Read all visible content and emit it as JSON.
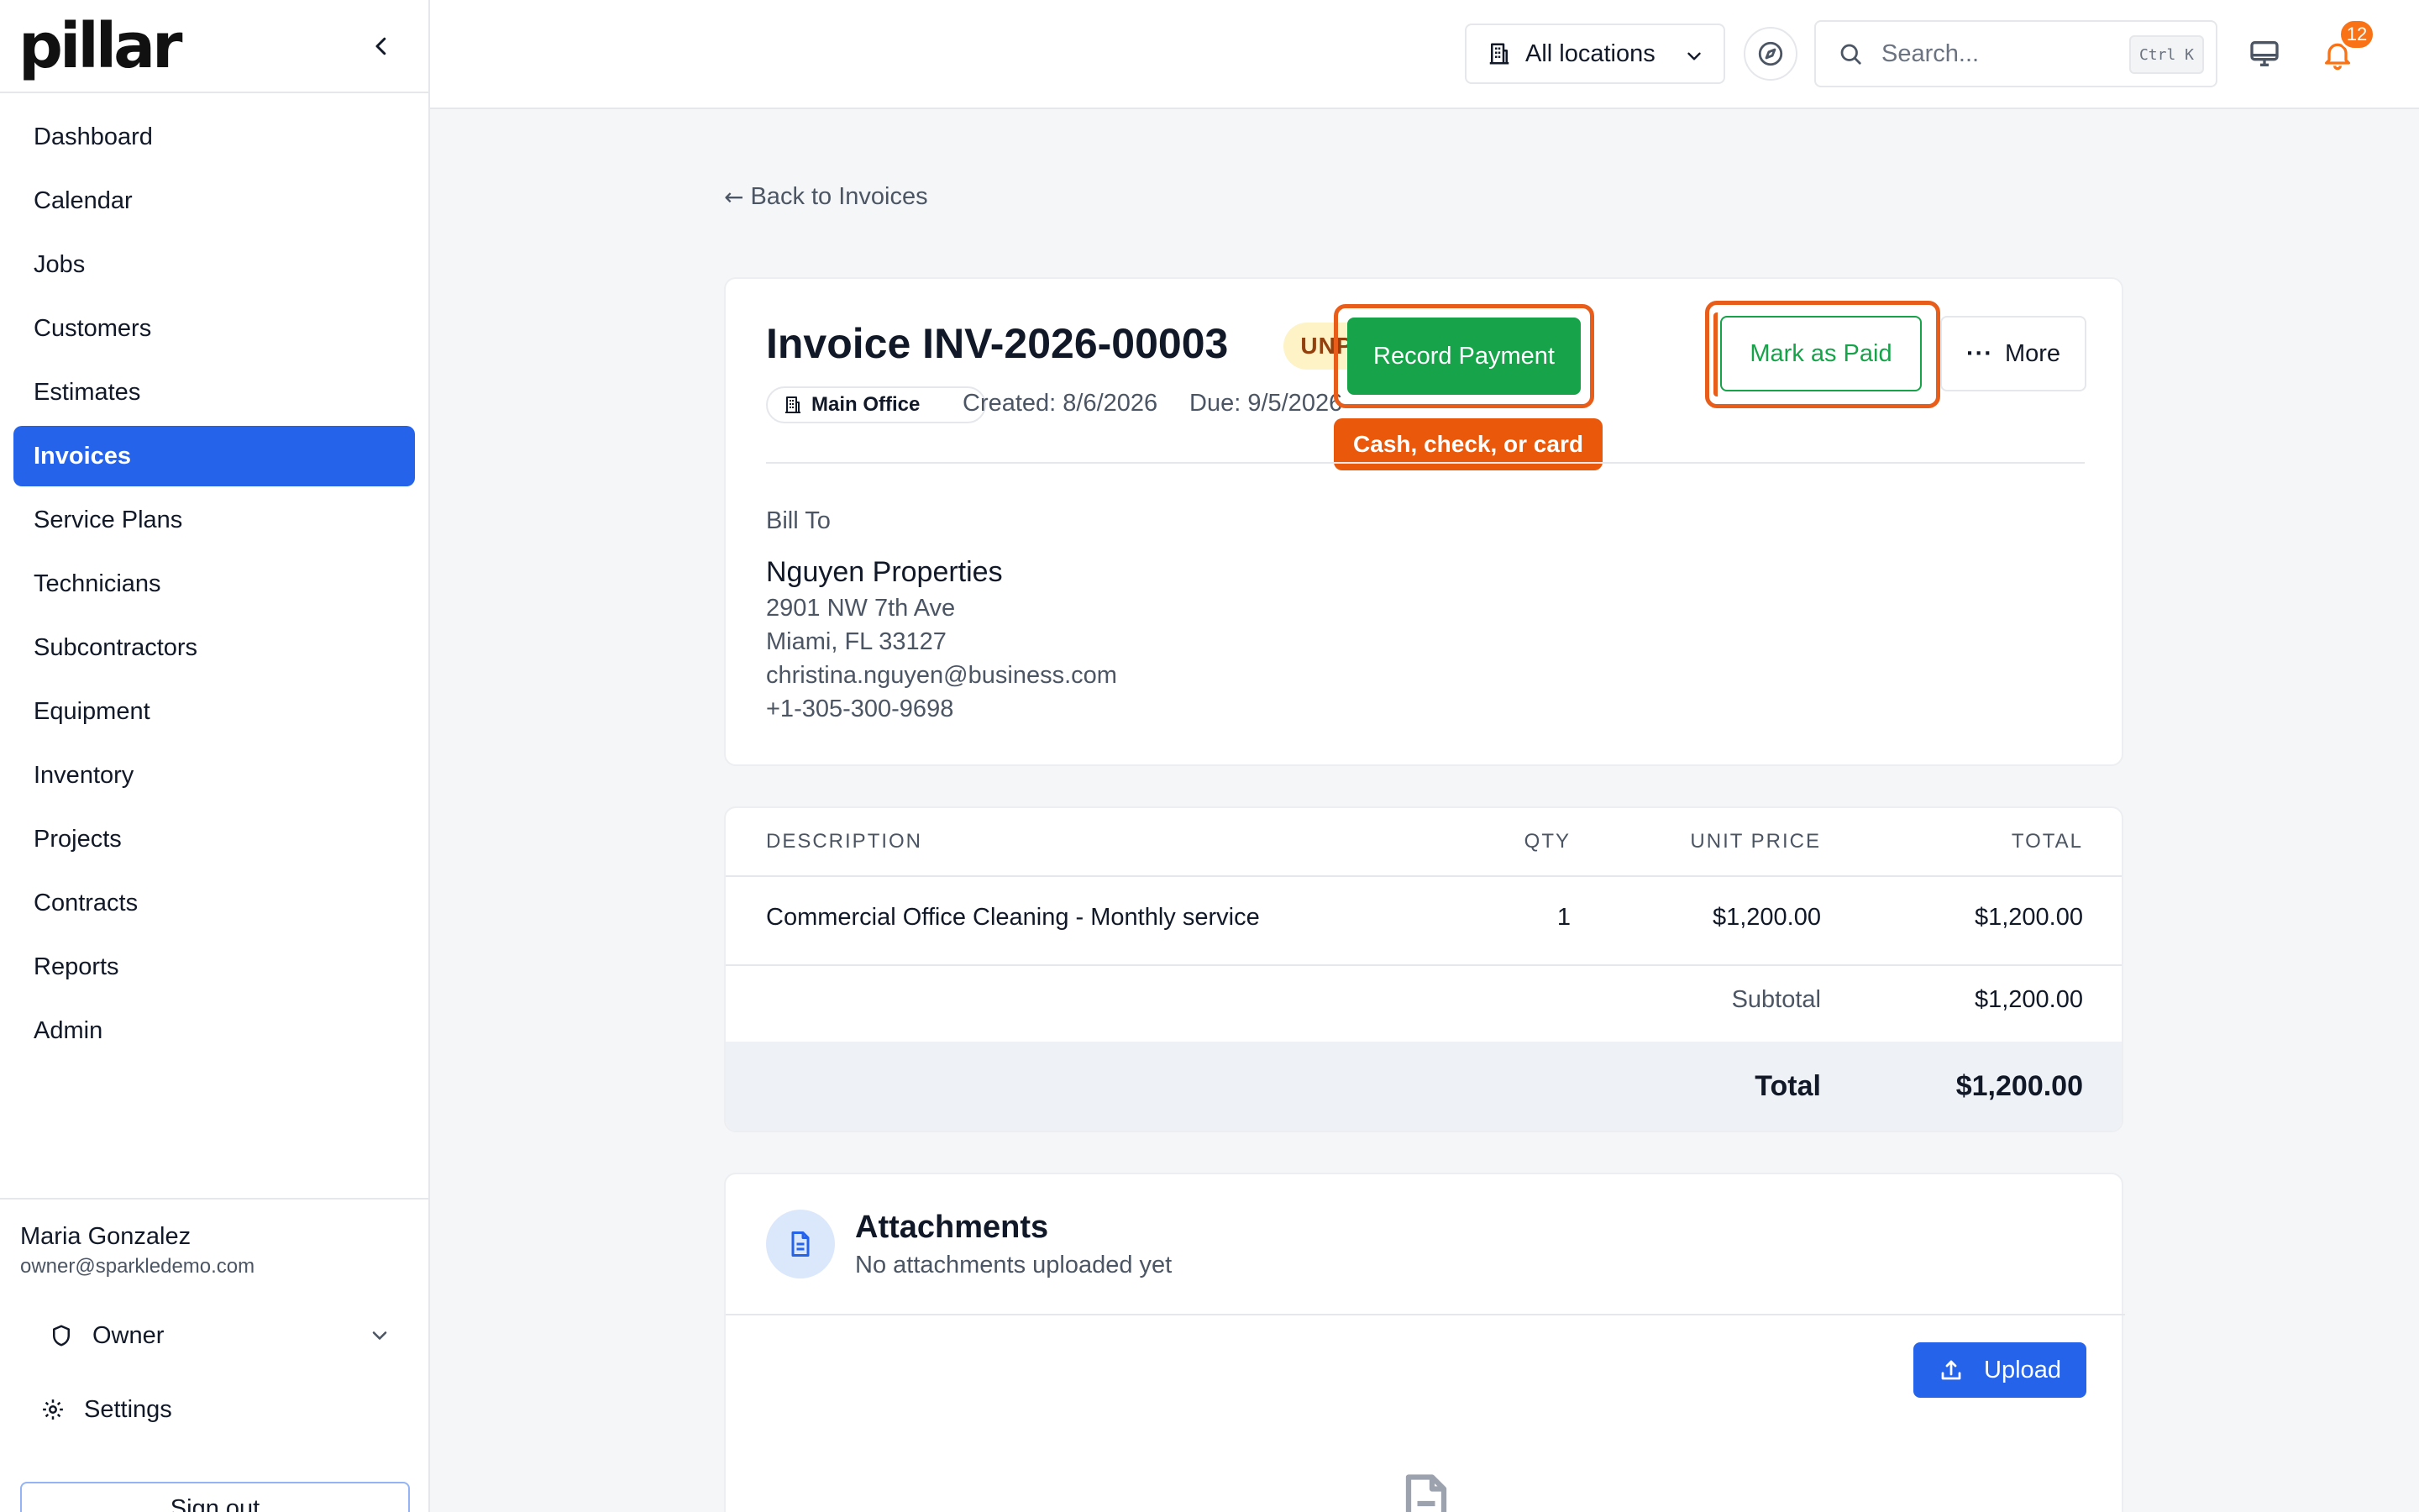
{
  "sidebar": {
    "logo": "pillar",
    "items": [
      {
        "label": "Dashboard"
      },
      {
        "label": "Calendar"
      },
      {
        "label": "Jobs"
      },
      {
        "label": "Customers"
      },
      {
        "label": "Estimates"
      },
      {
        "label": "Invoices",
        "active": true
      },
      {
        "label": "Service Plans"
      },
      {
        "label": "Technicians"
      },
      {
        "label": "Subcontractors"
      },
      {
        "label": "Equipment"
      },
      {
        "label": "Inventory"
      },
      {
        "label": "Projects"
      },
      {
        "label": "Contracts"
      },
      {
        "label": "Reports"
      },
      {
        "label": "Admin"
      }
    ],
    "user": {
      "name": "Maria Gonzalez",
      "email": "owner@sparkledemo.com",
      "role": "Owner",
      "settings_label": "Settings",
      "signout_label": "Sign out"
    }
  },
  "topbar": {
    "location_select": "All locations",
    "search_placeholder": "Search...",
    "search_shortcut": "Ctrl K",
    "notification_count": "12"
  },
  "main": {
    "back_link": "Back to Invoices",
    "invoice": {
      "title": "Invoice INV-2026-00003",
      "status": "UNPAID",
      "location": "Main Office",
      "created": "Created: 8/6/2026",
      "due": "Due: 9/5/2026",
      "actions": {
        "record_payment": "Record Payment",
        "mark_paid": "Mark as Paid",
        "more": "More",
        "tooltip": "Cash, check, or card"
      },
      "bill_to": {
        "label": "Bill To",
        "name": "Nguyen Properties",
        "address1": "2901 NW 7th Ave",
        "address2": "Miami, FL 33127",
        "email": "christina.nguyen@business.com",
        "phone": "+1-305-300-9698"
      }
    },
    "line_items": {
      "headers": {
        "description": "DESCRIPTION",
        "qty": "QTY",
        "unit_price": "UNIT PRICE",
        "total": "TOTAL"
      },
      "rows": [
        {
          "description": "Commercial Office Cleaning - Monthly service",
          "qty": "1",
          "unit_price": "$1,200.00",
          "total": "$1,200.00"
        }
      ],
      "subtotal_label": "Subtotal",
      "subtotal": "$1,200.00",
      "total_label": "Total",
      "total": "$1,200.00"
    },
    "attachments": {
      "title": "Attachments",
      "subtitle": "No attachments uploaded yet",
      "upload_label": "Upload"
    }
  },
  "colors": {
    "accent": "#2563eb",
    "success": "#16a34a",
    "highlight": "#ea580c",
    "unpaid_bg": "#fef3c7",
    "unpaid_text": "#92400e"
  },
  "icons": [
    "chevron-left-icon",
    "building-icon",
    "chevron-down-icon",
    "compass-icon",
    "search-icon",
    "monitor-icon",
    "bell-icon",
    "arrow-left-icon",
    "ellipsis-icon",
    "shield-icon",
    "gear-icon",
    "document-icon",
    "upload-icon"
  ]
}
